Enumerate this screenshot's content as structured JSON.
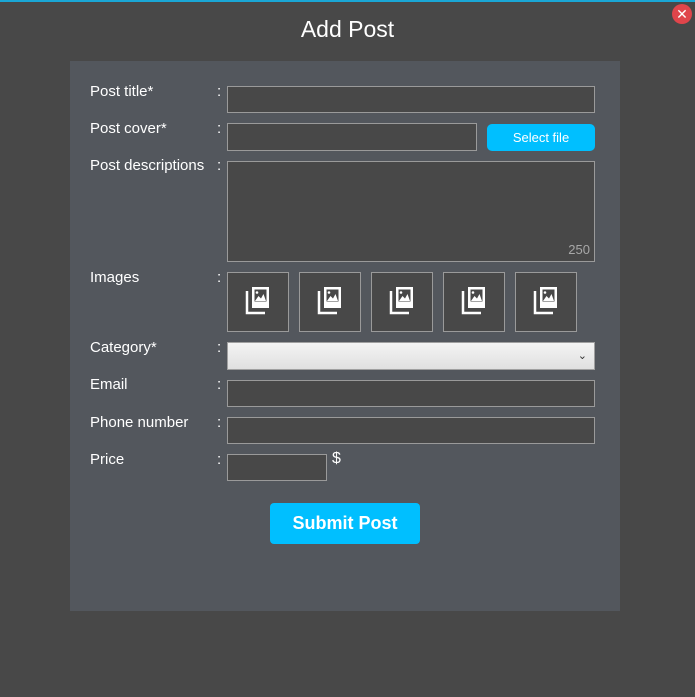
{
  "dialog": {
    "title": "Add Post",
    "close_glyph": "✕",
    "accent_color": "#00bfff"
  },
  "form": {
    "separator": ":",
    "post_title": {
      "label": "Post title*",
      "value": ""
    },
    "post_cover": {
      "label": "Post cover*",
      "value": "",
      "button_label": "Select file"
    },
    "post_descriptions": {
      "label": "Post descriptions",
      "value": "",
      "counter": "250"
    },
    "images": {
      "label": "Images",
      "slot_count": 5,
      "icon": "image-gallery-icon"
    },
    "category": {
      "label": "Category*",
      "selected": ""
    },
    "email": {
      "label": "Email",
      "value": ""
    },
    "phone_number": {
      "label": "Phone number",
      "value": ""
    },
    "price": {
      "label": "Price",
      "value": "",
      "currency": "$"
    },
    "submit_label": "Submit Post"
  }
}
